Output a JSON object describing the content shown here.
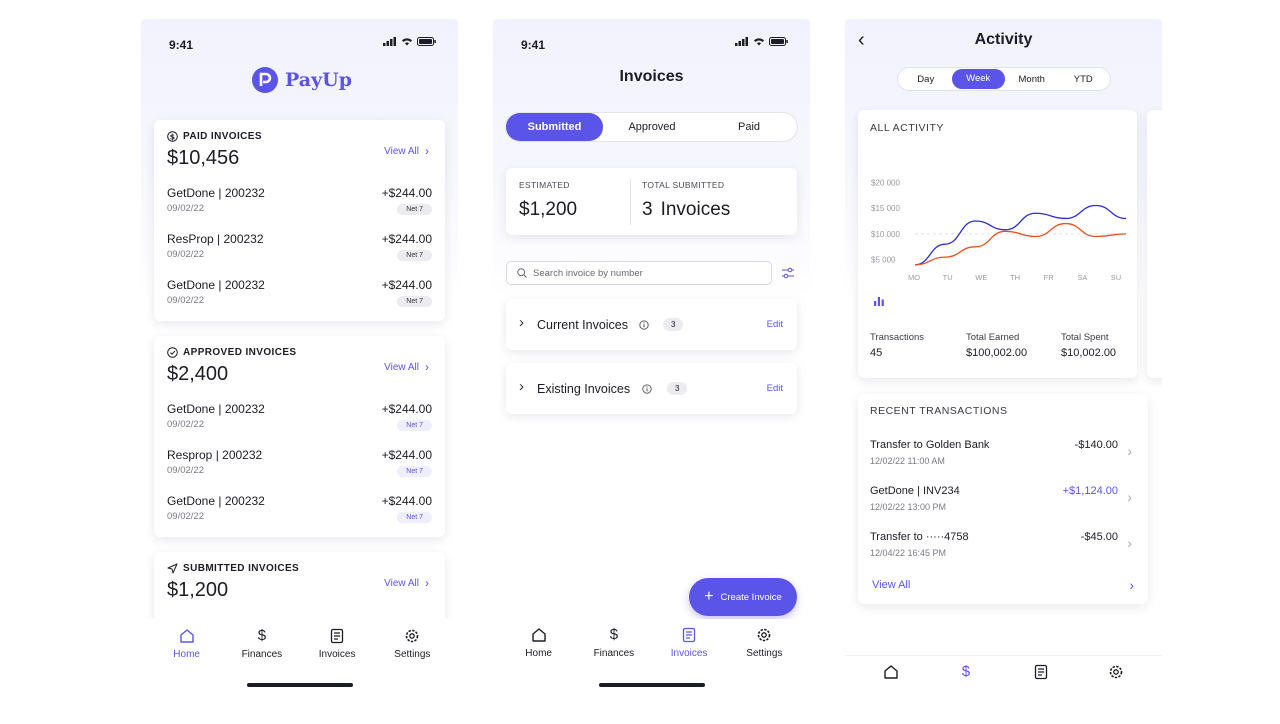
{
  "status": {
    "time": "9:41"
  },
  "screen1": {
    "brand": "PayUp",
    "sections": [
      {
        "title": "PAID INVOICES",
        "amount": "$10,456",
        "view_all": "View All",
        "rows": [
          {
            "name": "GetDone | 200232",
            "date": "09/02/22",
            "amount": "+$244.00",
            "term": "Net 7"
          },
          {
            "name": "ResProp | 200232",
            "date": "09/02/22",
            "amount": "+$244.00",
            "term": "Net 7"
          },
          {
            "name": "GetDone | 200232",
            "date": "09/02/22",
            "amount": "+$244.00",
            "term": "Net 7"
          }
        ]
      },
      {
        "title": "APPROVED INVOICES",
        "amount": "$2,400",
        "view_all": "View All",
        "rows": [
          {
            "name": "GetDone | 200232",
            "date": "09/02/22",
            "amount": "+$244.00",
            "term": "Net 7"
          },
          {
            "name": "Resprop | 200232",
            "date": "09/02/22",
            "amount": "+$244.00",
            "term": "Net 7"
          },
          {
            "name": "GetDone | 200232",
            "date": "09/02/22",
            "amount": "+$244.00",
            "term": "Net 7"
          }
        ]
      },
      {
        "title": "SUBMITTED INVOICES",
        "amount": "$1,200",
        "view_all": "View All",
        "rows": []
      }
    ],
    "tabs": [
      "Home",
      "Finances",
      "Invoices",
      "Settings"
    ]
  },
  "screen2": {
    "title": "Invoices",
    "segments": [
      "Submitted",
      "Approved",
      "Paid"
    ],
    "estimated_label": "ESTIMATED",
    "estimated_value": "$1,200",
    "total_label": "TOTAL SUBMITTED",
    "total_count": "3",
    "total_unit": "Invoices",
    "search_placeholder": "Search invoice by number",
    "groups": [
      {
        "label": "Current Invoices",
        "count": "3",
        "action": "Edit"
      },
      {
        "label": "Existing Invoices",
        "count": "3",
        "action": "Edit"
      }
    ],
    "fab_label": "Create Invoice",
    "tabs": [
      "Home",
      "Finances",
      "Invoices",
      "Settings"
    ]
  },
  "screen3": {
    "title": "Activity",
    "periods": [
      "Day",
      "Week",
      "Month",
      "YTD"
    ],
    "chart_title": "ALL ACTIVITY",
    "stats": [
      {
        "label": "Transactions",
        "value": "45"
      },
      {
        "label": "Total Earned",
        "value": "$100,002.00"
      },
      {
        "label": "Total Spent",
        "value": "$10,002.00"
      }
    ],
    "recent_title": "RECENT TRANSACTIONS",
    "transactions": [
      {
        "name": "Transfer to Golden Bank",
        "date": "12/02/22  11:00 AM",
        "amount": "-$140.00",
        "positive": false
      },
      {
        "name": "GetDone | INV234",
        "date": "12/02/22  13:00 PM",
        "amount": "+$1,124.00",
        "positive": true
      },
      {
        "name": "Transfer to ·····4758",
        "date": "12/04/22  16:45 PM",
        "amount": "-$45.00",
        "positive": false
      }
    ],
    "view_all": "View All"
  },
  "chart_data": {
    "type": "line",
    "title": "ALL ACTIVITY",
    "categories": [
      "MO",
      "TU",
      "WE",
      "TH",
      "FR",
      "SA",
      "SU"
    ],
    "yticks": [
      "$5 000",
      "$10 000",
      "$15 000",
      "$20 000"
    ],
    "ylim": [
      3000,
      22000
    ],
    "series": [
      {
        "color": "#2f2bd6",
        "values": [
          4000,
          8000,
          12500,
          10800,
          14000,
          13000,
          15500,
          13000
        ]
      },
      {
        "color": "#e8501c",
        "values": [
          4000,
          5500,
          7500,
          10500,
          9500,
          12000,
          9500,
          10000
        ]
      }
    ],
    "accent": "#5b54e8"
  }
}
